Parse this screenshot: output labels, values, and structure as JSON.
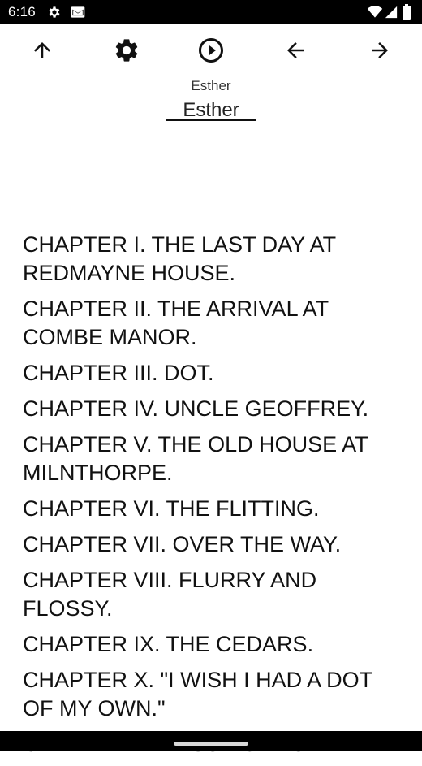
{
  "status_bar": {
    "time": "6:16",
    "icons": [
      "gear-icon",
      "mail-icon",
      "wifi-icon",
      "signal-icon",
      "battery-icon"
    ]
  },
  "toolbar": {
    "buttons": [
      "arrow-up-icon",
      "settings-icon",
      "play-icon",
      "arrow-back-icon",
      "arrow-forward-icon"
    ]
  },
  "book": {
    "title_small": "Esther",
    "title_large": "Esther"
  },
  "chapters": [
    "CHAPTER I. THE LAST DAY AT REDMAYNE HOUSE.",
    "CHAPTER II. THE ARRIVAL AT COMBE MANOR.",
    "CHAPTER III. DOT.",
    "CHAPTER IV. UNCLE GEOFFREY.",
    "CHAPTER V. THE OLD HOUSE AT MILNTHORPE.",
    "CHAPTER VI. THE FLITTING.",
    "CHAPTER VII. OVER THE WAY.",
    "CHAPTER VIII. FLURRY AND FLOSSY.",
    "CHAPTER IX. THE CEDARS.",
    "CHAPTER X. \"I WISH I HAD A DOT OF MY OWN.\"",
    "CHAPTER XI. MISS RUTH'S"
  ],
  "colors": {
    "status_bar_bg": "#000000",
    "background": "#ffffff",
    "text": "#111111"
  }
}
